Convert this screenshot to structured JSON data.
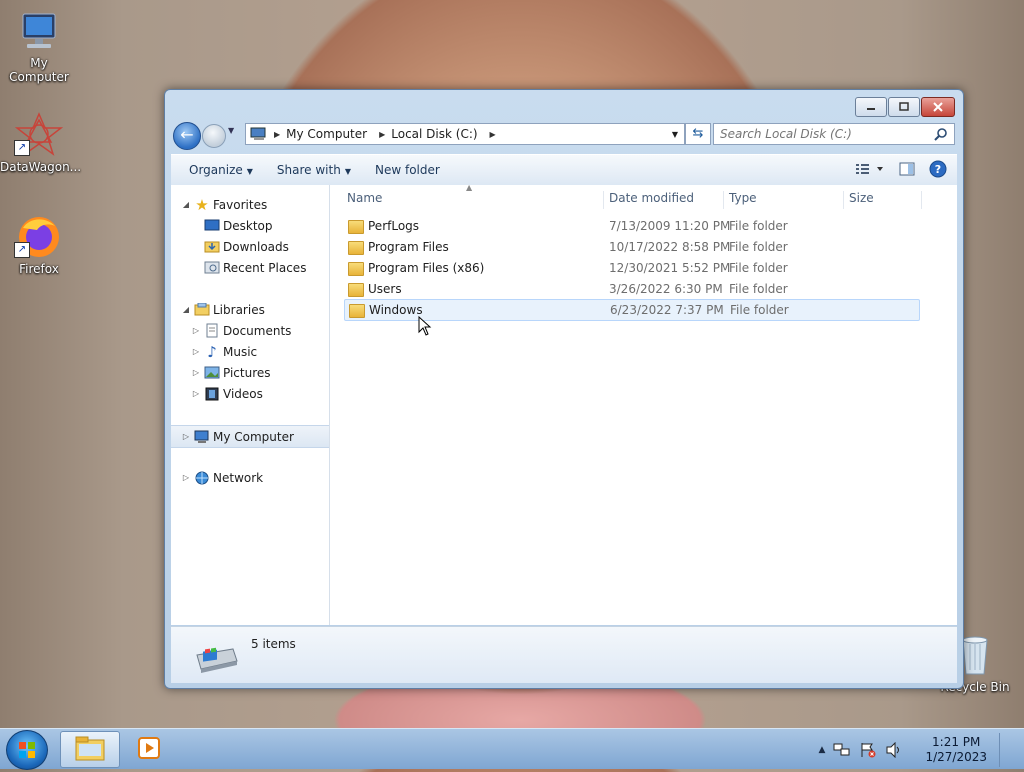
{
  "desktop": {
    "icons": [
      {
        "label": "My Computer"
      },
      {
        "label": "DataWagon..."
      },
      {
        "label": "Firefox"
      },
      {
        "label": "Recycle Bin"
      }
    ]
  },
  "window": {
    "address": {
      "segments": [
        "My Computer",
        "Local Disk (C:)"
      ]
    },
    "search": {
      "placeholder": "Search Local Disk (C:)"
    },
    "toolbar": {
      "organize": "Organize",
      "share_with": "Share with",
      "new_folder": "New folder"
    },
    "nav": {
      "favorites": "Favorites",
      "desktop": "Desktop",
      "downloads": "Downloads",
      "recent_places": "Recent Places",
      "libraries": "Libraries",
      "documents": "Documents",
      "music": "Music",
      "pictures": "Pictures",
      "videos": "Videos",
      "my_computer": "My Computer",
      "network": "Network"
    },
    "columns": {
      "name": "Name",
      "date_modified": "Date modified",
      "type": "Type",
      "size": "Size"
    },
    "files": [
      {
        "name": "PerfLogs",
        "date": "7/13/2009 11:20 PM",
        "type": "File folder"
      },
      {
        "name": "Program Files",
        "date": "10/17/2022 8:58 PM",
        "type": "File folder"
      },
      {
        "name": "Program Files (x86)",
        "date": "12/30/2021 5:52 PM",
        "type": "File folder"
      },
      {
        "name": "Users",
        "date": "3/26/2022 6:30 PM",
        "type": "File folder"
      },
      {
        "name": "Windows",
        "date": "6/23/2022 7:37 PM",
        "type": "File folder"
      }
    ],
    "status": {
      "item_count": "5 items"
    }
  },
  "taskbar": {
    "clock_time": "1:21 PM",
    "clock_date": "1/27/2023"
  }
}
